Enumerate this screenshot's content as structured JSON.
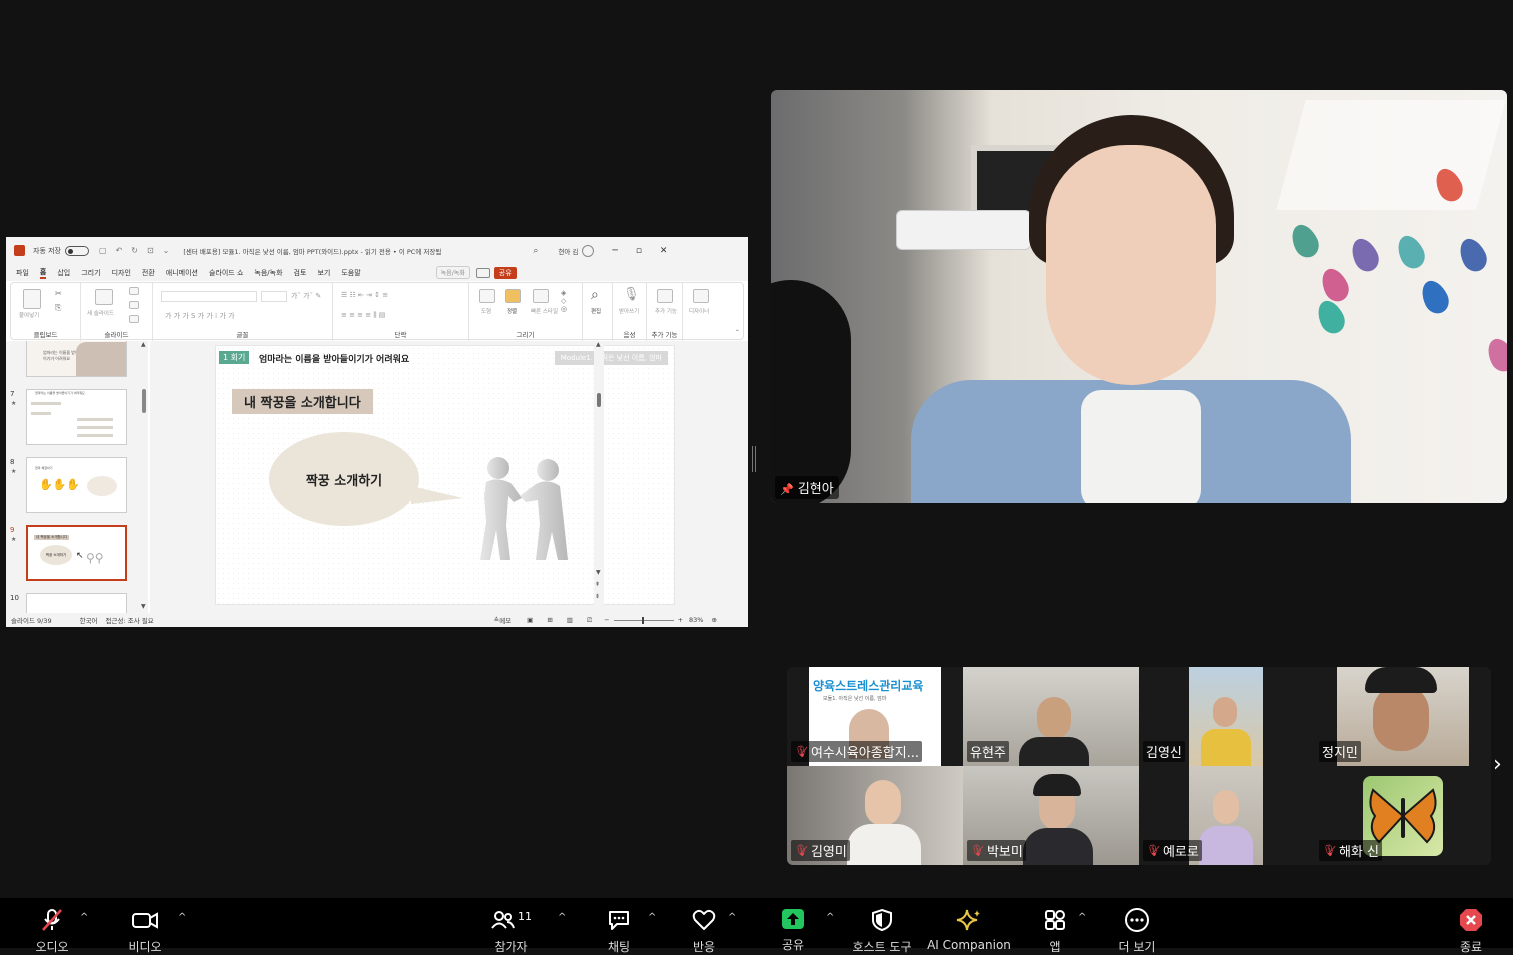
{
  "powerpoint": {
    "autosave_label": "자동 저장",
    "autosave_state": "끔",
    "doc_title": "[센터 배포용] 모듈1. 아직은 낯선 이름, 엄마 PPT(와이드).pptx  -  읽기 전용 • 이 PC에 저장됨",
    "user_name": "현아 김",
    "menu": [
      "파일",
      "홈",
      "삽입",
      "그리기",
      "디자인",
      "전환",
      "애니메이션",
      "슬라이드 쇼",
      "녹음/녹화",
      "검토",
      "보기",
      "도움말"
    ],
    "active_menu": "홈",
    "record_label": "녹음/녹화",
    "share_label": "공유",
    "ribbon_groups": [
      "클립보드",
      "슬라이드",
      "글꼴",
      "단락",
      "그리기",
      "음성",
      "추가 기능"
    ],
    "ribbon_buttons": {
      "paste": "붙여넣기",
      "new_slide": "새 슬라이드",
      "shapes": "도형",
      "arrange": "정렬",
      "quick_styles": "빠른 스타일",
      "edit": "편집",
      "dictate": "받아쓰기",
      "addins": "추가 기능",
      "designer": "디자이너"
    },
    "thumbnails": [
      {
        "num": "7",
        "title": "엄마라는 이름을 받아들이기가 어려워요"
      },
      {
        "num": "8",
        "title": "엄마 체험하기"
      },
      {
        "num": "9",
        "title": "내 짝꿍을 소개합니다",
        "bubble": "짝꿍 소개하기",
        "selected": true
      },
      {
        "num": "10",
        "title": ""
      }
    ],
    "thumb6_caption": "엄마라는 이름을 받아들이기가 어려워요",
    "slide": {
      "session_badge": "1 회기",
      "title": "엄마라는 이름을 받아들이기가 어려워요",
      "module_tag": "Module1. 아직은 낯선 이름, 엄마",
      "heading": "내 짝꿍을 소개합니다",
      "bubble_text": "짝꿍 소개하기"
    },
    "status": {
      "slide_count": "슬라이드 9/39",
      "language": "한국어",
      "accessibility": "접근성: 조사 필요",
      "notes": "메모",
      "zoom": "83%"
    }
  },
  "main_video": {
    "name": "김현아",
    "pinned": true
  },
  "gallery": {
    "tiles": [
      {
        "name": "여수시육아종합지...",
        "muted": true,
        "poster_title": "양육스트레스관리교육",
        "poster_sub": "모듈1. 아직은 낯선 이름, 엄마"
      },
      {
        "name": "유현주",
        "muted": false
      },
      {
        "name": "김영신",
        "muted": false
      },
      {
        "name": "정지민",
        "muted": false
      },
      {
        "name": "김영미",
        "muted": true
      },
      {
        "name": "박보미",
        "muted": true
      },
      {
        "name": "예로로",
        "muted": true
      },
      {
        "name": "해화 신",
        "muted": true
      }
    ]
  },
  "toolbar": {
    "audio": "오디오",
    "video": "비디오",
    "participants": "참가자",
    "participants_count": "11",
    "chat": "채팅",
    "reactions": "반응",
    "share": "공유",
    "host_tools": "호스트 도구",
    "ai_companion": "AI Companion",
    "apps": "앱",
    "more": "더 보기",
    "end": "종료"
  },
  "colors": {
    "background": "#121212",
    "ppt_accent": "#c43e1c",
    "share_green": "#22c55e",
    "muted_red": "#e5484d",
    "ai_yellow": "#e8c547",
    "end_red": "#e5484d"
  }
}
